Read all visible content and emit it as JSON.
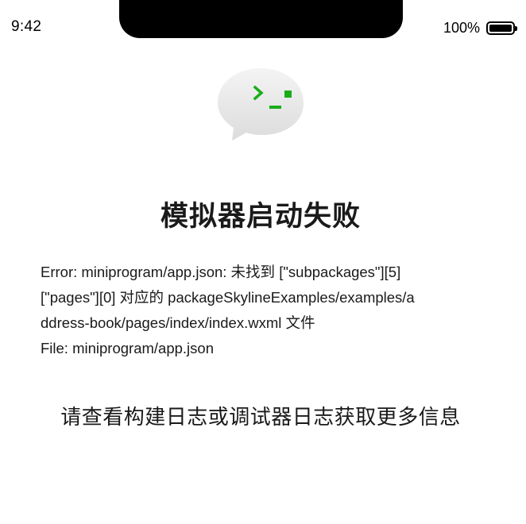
{
  "status_bar": {
    "time": "9:42",
    "battery_percent": "100%",
    "battery_level": 1.0
  },
  "logo": {
    "icon": "wechat-devtools-terminal-icon",
    "accent_color": "#1aad19"
  },
  "title": "模拟器启动失败",
  "error": {
    "lines": [
      "Error: miniprogram/app.json: 未找到 [\"subpackages\"][5]",
      "[\"pages\"][0] 对应的 packageSkylineExamples/examples/a",
      "ddress-book/pages/index/index.wxml 文件",
      "File: miniprogram/app.json"
    ]
  },
  "hint": "请查看构建日志或调试器日志获取更多信息"
}
